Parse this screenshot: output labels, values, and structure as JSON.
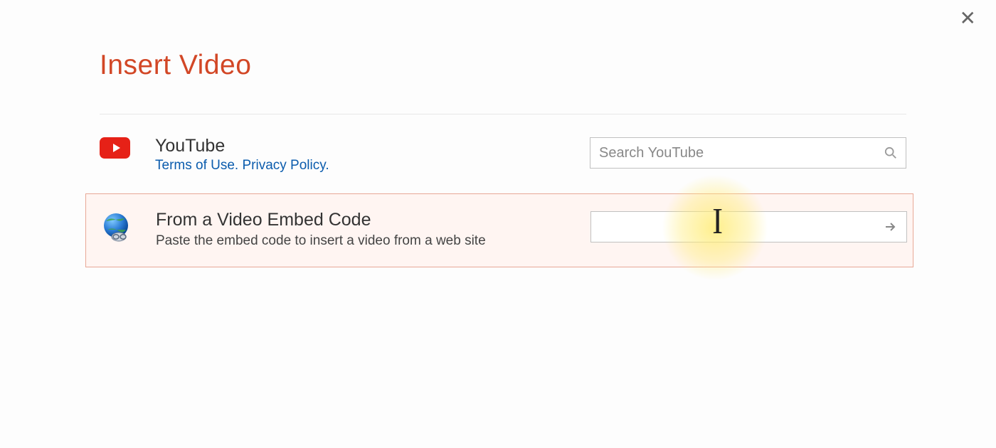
{
  "dialog": {
    "title": "Insert Video",
    "close_label": "✕"
  },
  "youtube": {
    "title": "YouTube",
    "terms_label": "Terms of Use.",
    "privacy_label": "Privacy Policy.",
    "search_placeholder": "Search YouTube"
  },
  "embed": {
    "title": "From a Video Embed Code",
    "description": "Paste the embed code to insert a video from a web site",
    "input_placeholder": ""
  }
}
